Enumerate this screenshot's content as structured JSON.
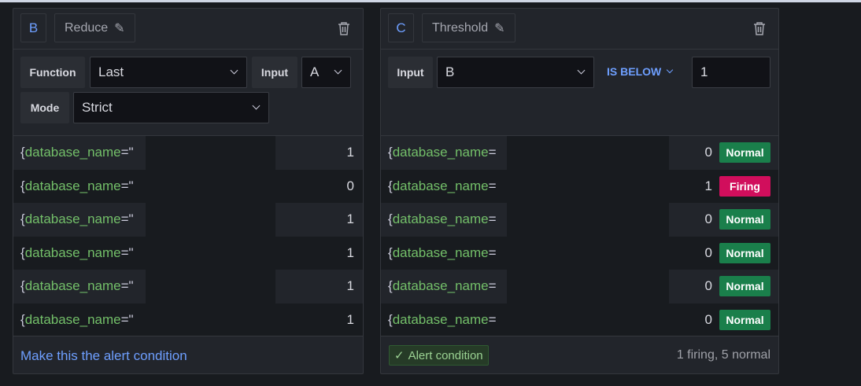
{
  "reduce": {
    "ref_id": "B",
    "name": "Reduce",
    "function_label": "Function",
    "function_value": "Last",
    "input_label": "Input",
    "input_value": "A",
    "mode_label": "Mode",
    "mode_value": "Strict",
    "rows": [
      {
        "key": "database_name",
        "sep": "=\"",
        "value": "1"
      },
      {
        "key": "database_name",
        "sep": "=\"",
        "value": "0"
      },
      {
        "key": "database_name",
        "sep": "=\"",
        "value": "1"
      },
      {
        "key": "database_name",
        "sep": "=\"",
        "value": "1"
      },
      {
        "key": "database_name",
        "sep": "=\"",
        "value": "1"
      },
      {
        "key": "database_name",
        "sep": "=\"",
        "value": "1"
      }
    ],
    "footer_link": "Make this the alert condition"
  },
  "threshold": {
    "ref_id": "C",
    "name": "Threshold",
    "input_label": "Input",
    "input_value": "B",
    "operator": "IS BELOW",
    "threshold_value": "1",
    "rows": [
      {
        "key": "database_name",
        "sep": "=",
        "value": "0",
        "state": "Normal"
      },
      {
        "key": "database_name",
        "sep": "=",
        "value": "1",
        "state": "Firing"
      },
      {
        "key": "database_name",
        "sep": "=",
        "value": "0",
        "state": "Normal"
      },
      {
        "key": "database_name",
        "sep": "=",
        "value": "0",
        "state": "Normal"
      },
      {
        "key": "database_name",
        "sep": "=",
        "value": "0",
        "state": "Normal"
      },
      {
        "key": "database_name",
        "sep": "=",
        "value": "0",
        "state": "Normal"
      }
    ],
    "alert_condition_label": "Alert condition",
    "summary": "1 firing, 5 normal"
  },
  "colors": {
    "normal": "#1a7f4b",
    "firing": "#d10e5c",
    "accent": "#6e9fff",
    "label_green": "#73bf69"
  }
}
